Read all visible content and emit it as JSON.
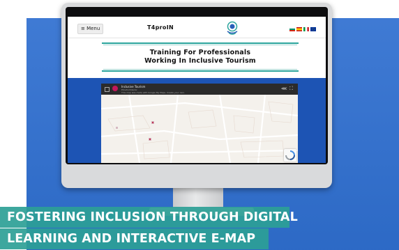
{
  "website": {
    "menu_label": "≡ Menu",
    "site_title": "T4proIN",
    "logo_icon": "t4proin-logo-icon",
    "languages": [
      {
        "name": "bulgarian-flag-icon",
        "colors": [
          "#ffffff",
          "#00966e",
          "#d62612"
        ]
      },
      {
        "name": "spanish-flag-icon",
        "colors": [
          "#c60b1e",
          "#ffc400",
          "#c60b1e"
        ]
      },
      {
        "name": "italian-flag-icon",
        "colors": [
          "#009246",
          "#ffffff",
          "#ce2b37"
        ]
      },
      {
        "name": "eu-flag-icon",
        "colors": [
          "#003399",
          "#003399",
          "#003399"
        ]
      }
    ],
    "banner_line1": "Training For Professionals",
    "banner_line2": "Working In Inclusive Tourism"
  },
  "map_embed": {
    "title": "Inclusive Tourism",
    "subtitle": "Plovdiv/Interior",
    "note": "This map was made with Google My Maps. Create your own.",
    "share_icon": "share-icon",
    "fullscreen_icon": "fullscreen-icon",
    "recaptcha_icon": "recaptcha-icon"
  },
  "captions": {
    "line1": "FOSTERING INCLUSION THROUGH DIGITAL",
    "line2": "LEARNING AND INTERACTIVE E-MAP"
  },
  "colors": {
    "background_blue": "#2f6fd0",
    "content_blue": "#1d54b4",
    "caption_teal": "#2ca096",
    "banner_teal": "#2aa49c"
  }
}
